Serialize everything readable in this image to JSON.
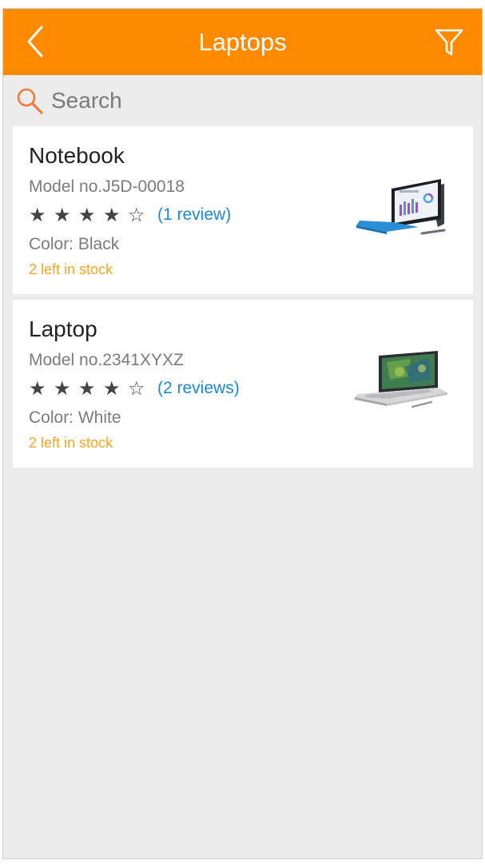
{
  "header": {
    "title": "Laptops",
    "back_icon": "chevron-left-icon",
    "filter_icon": "filter-icon",
    "background_color": "#ff8a00"
  },
  "search": {
    "placeholder": "Search",
    "icon": "search-icon"
  },
  "products": [
    {
      "name": "Notebook",
      "model": "Model no.J5D-00018",
      "rating": 4,
      "max_rating": 5,
      "reviews": "(1 review)",
      "color": "Color: Black",
      "stock": "2 left in stock",
      "image": "surface-pro-tablet-image"
    },
    {
      "name": "Laptop",
      "model": "Model no.2341XYXZ",
      "rating": 4,
      "max_rating": 5,
      "reviews": "(2 reviews)",
      "color": "Color: White",
      "stock": "2 left in stock",
      "image": "surface-book-laptop-image"
    }
  ],
  "colors": {
    "accent": "#ff8a00",
    "link": "#1e88d6",
    "stock": "#f5a623",
    "background": "#ececec"
  }
}
